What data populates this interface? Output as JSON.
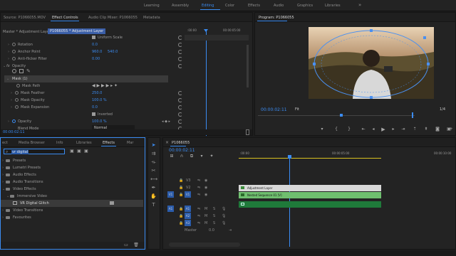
{
  "workspaces": {
    "items": [
      "Learning",
      "Assembly",
      "Editing",
      "Color",
      "Effects",
      "Audio",
      "Graphics",
      "Libraries"
    ],
    "active": "Editing",
    "more": "»"
  },
  "source_panel": {
    "tabs": [
      "Source: P1066055.MOV",
      "Effect Controls",
      "Audio Clip Mixer: P1066055",
      "Metadata"
    ],
    "active_tab": "Effect Controls",
    "master_label": "Master * Adjustment Layer",
    "clip_label": "P1066055 * Adjustment Layer",
    "timecode_head": ":00:00",
    "timecode_end": "00:00:05:00",
    "uniform_scale": "Uniform Scale",
    "rows": [
      {
        "name": "Rotation",
        "value": "0.0"
      },
      {
        "name": "Anchor Point",
        "value": "960.0",
        "value2": "540.0"
      },
      {
        "name": "Anti-flicker Filter",
        "value": "0.00"
      }
    ],
    "opacity_label": "Opacity",
    "mask_label": "Mask (1)",
    "mask_path": "Mask Path",
    "mask_rows": [
      {
        "name": "Mask Feather",
        "value": "250.0"
      },
      {
        "name": "Mask Opacity",
        "value": "100.0 %"
      },
      {
        "name": "Mask Expansion",
        "value": "0.0"
      }
    ],
    "inverted_label": "Inverted",
    "opacity_row": {
      "name": "Opacity",
      "value": "100.0 %"
    },
    "blend_mode": {
      "name": "Blend Mode",
      "value": "Normal"
    },
    "bottom_timecode": "00:00:02:11"
  },
  "program": {
    "title": "Program: P1066055",
    "timecode": "00:00:02:11",
    "fit": "Fit",
    "fraction": "1/4"
  },
  "effects_panel": {
    "tabs": [
      "ect",
      "Media Browser",
      "Info",
      "Libraries",
      "Effects",
      "Mar"
    ],
    "active_tab": "Effects",
    "search_value": "vr digital",
    "tree": [
      {
        "label": "Presets",
        "depth": 0
      },
      {
        "label": "Lumetri Presets",
        "depth": 0
      },
      {
        "label": "Audio Effects",
        "depth": 0
      },
      {
        "label": "Audio Transitions",
        "depth": 0
      },
      {
        "label": "Video Effects",
        "depth": 0,
        "open": true
      },
      {
        "label": "Immersive Video",
        "depth": 1,
        "open": true
      },
      {
        "label": "VR Digital Glitch",
        "depth": 2,
        "selected": true
      },
      {
        "label": "Video Transitions",
        "depth": 0
      },
      {
        "label": "Favourites",
        "depth": 0
      }
    ]
  },
  "timeline": {
    "tab": "P1066055",
    "timecode": "00:00:02:11",
    "ruler": [
      ":00:00",
      "00:00:05:00",
      "00:00:10:00"
    ],
    "video_tracks": [
      "V3",
      "V2",
      "V1"
    ],
    "audio_tracks": [
      "A1",
      "A2",
      "A3"
    ],
    "source_patch": [
      "V1",
      "A1"
    ],
    "master_label": "Master",
    "master_value": "0.0",
    "clips": [
      {
        "name": "Adjustment Layer",
        "color": "#d8d8d8"
      },
      {
        "name": "Nested Sequence 01 [V]",
        "color": "#6fbf6f"
      }
    ],
    "track_letters": [
      "M",
      "S"
    ]
  },
  "colors": {
    "accent": "#3b8cf2",
    "clip_adjustment": "#d8d8d8",
    "clip_nested": "#6fbf6f",
    "clip_audio": "#1f7a3a"
  }
}
